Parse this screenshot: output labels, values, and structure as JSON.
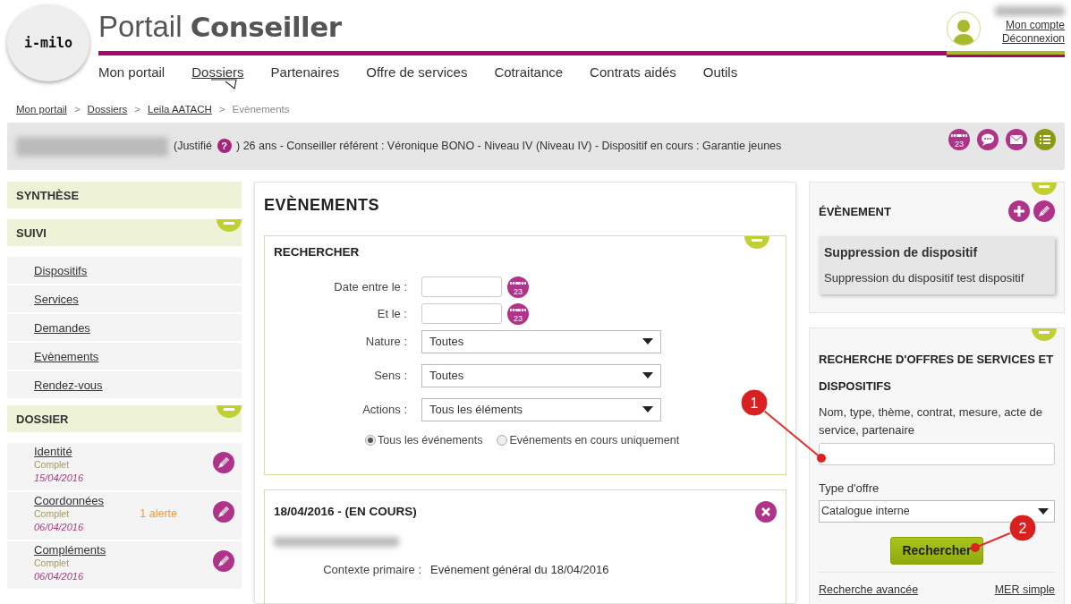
{
  "header": {
    "title_light": "Portail",
    "title_bold": "Conseiller",
    "logo_text": "i-milo",
    "account_links": [
      "Mon compte",
      "Déconnexion"
    ]
  },
  "nav": [
    {
      "label": "Mon portail",
      "selected": false
    },
    {
      "label": "Dossiers",
      "selected": true
    },
    {
      "label": "Partenaires",
      "selected": false
    },
    {
      "label": "Offre de services",
      "selected": false
    },
    {
      "label": "Cotraitance",
      "selected": false
    },
    {
      "label": "Contrats aidés",
      "selected": false
    },
    {
      "label": "Outils",
      "selected": false
    }
  ],
  "breadcrumb": {
    "separator": ">",
    "items": [
      {
        "label": "Mon portail",
        "kind": "link"
      },
      {
        "label": "Dossiers",
        "kind": "link"
      },
      {
        "label": "Leila AATACH",
        "kind": "link"
      },
      {
        "label": "Evènements",
        "kind": "current"
      }
    ]
  },
  "info_bar": {
    "status_open": "(Justifié",
    "help": "?",
    "details": ") 26 ans - Conseiller référent : Véronique BONO - Niveau IV (Niveau IV) - Dispositif en cours : Garantie jeunes",
    "actions": [
      {
        "kind": "calendar",
        "label": "23",
        "color": "#b0338a"
      },
      {
        "kind": "chat",
        "color": "#b0338a"
      },
      {
        "kind": "mail",
        "color": "#b0338a"
      },
      {
        "kind": "list",
        "color": "#8a9a12"
      }
    ]
  },
  "sidebar": [
    {
      "title": "SYNTHÈSE",
      "collapsible": false
    },
    {
      "title": "SUIVI",
      "collapsible": true,
      "items": [
        {
          "kind": "link",
          "label": "Dispositifs"
        },
        {
          "kind": "link",
          "label": "Services"
        },
        {
          "kind": "link",
          "label": "Demandes"
        },
        {
          "kind": "link",
          "label": "Evènements"
        },
        {
          "kind": "link",
          "label": "Rendez-vous"
        }
      ]
    },
    {
      "title": "DOSSIER",
      "collapsible": true,
      "items": [
        {
          "kind": "record",
          "label": "Identité",
          "status": "Complet",
          "date": "15/04/2016"
        },
        {
          "kind": "record",
          "label": "Coordonnées",
          "status": "Complet",
          "date": "06/04/2016",
          "alert": "1 alerte"
        },
        {
          "kind": "record",
          "label": "Compléments",
          "status": "Complet",
          "date": "06/04/2016"
        }
      ]
    }
  ],
  "main": {
    "title": "EVÈNEMENTS",
    "search": {
      "title": "RECHERCHER",
      "fields": [
        {
          "kind": "date",
          "label": "Date entre le :",
          "calendar_label": "23"
        },
        {
          "kind": "date",
          "label": "Et le :",
          "calendar_label": "23"
        },
        {
          "kind": "select",
          "label": "Nature :",
          "value": "Toutes"
        },
        {
          "kind": "select",
          "label": "Sens :",
          "value": "Toutes"
        },
        {
          "kind": "select",
          "label": "Actions :",
          "value": "Tous les éléments"
        }
      ],
      "radios": [
        {
          "label": "Tous les événements",
          "selected": true
        },
        {
          "label": "Evénements en cours uniquement",
          "selected": false
        }
      ]
    },
    "event": {
      "title": "18/04/2016 - (EN COURS)",
      "rows": [
        {
          "label": "Contexte primaire :",
          "value": "Evénement général du 18/04/2016"
        }
      ]
    }
  },
  "right": {
    "event_panel": {
      "title": "ÉVÈNEMENT",
      "card_title": "Suppression de dispositif",
      "card_text": "Suppression du dispositif test dispositif"
    },
    "offer_search": {
      "title": "RECHERCHE D'OFFRES DE SERVICES ET DISPOSITIFS",
      "field_label": "Nom, type, thème, contrat, mesure, acte de service, partenaire",
      "type_label": "Type d'offre",
      "type_value": "Catalogue interne",
      "button": "Rechercher",
      "links": [
        "Recherche avancée",
        "MER simple"
      ]
    }
  },
  "annotations": [
    {
      "label": "1"
    },
    {
      "label": "2"
    }
  ]
}
